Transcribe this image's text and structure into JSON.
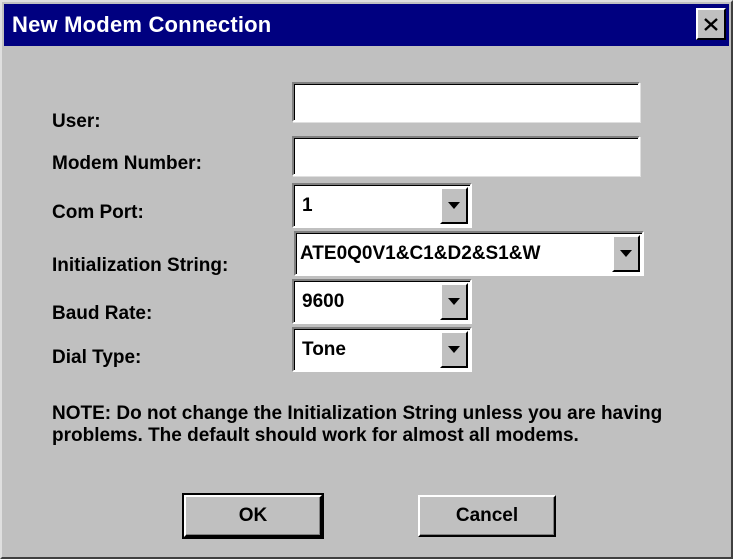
{
  "window": {
    "title": "New Modem Connection"
  },
  "form": {
    "user": {
      "label": "User:",
      "value": ""
    },
    "modem_number": {
      "label": "Modem Number:",
      "value": ""
    },
    "com_port": {
      "label": "Com Port:",
      "value": "1"
    },
    "init_string": {
      "label": "Initialization String:",
      "value": "ATE0Q0V1&C1&D2&S1&W"
    },
    "baud_rate": {
      "label": "Baud Rate:",
      "value": "9600"
    },
    "dial_type": {
      "label": "Dial Type:",
      "value": "Tone"
    }
  },
  "note": "NOTE: Do not change the Initialization String unless you are having problems.  The default should work for almost all modems.",
  "buttons": {
    "ok": "OK",
    "cancel": "Cancel"
  },
  "colors": {
    "titlebar": "#000080",
    "face": "#c0c0c0"
  },
  "icons": {
    "close": "close-icon",
    "dropdown": "dropdown-arrow-icon"
  }
}
